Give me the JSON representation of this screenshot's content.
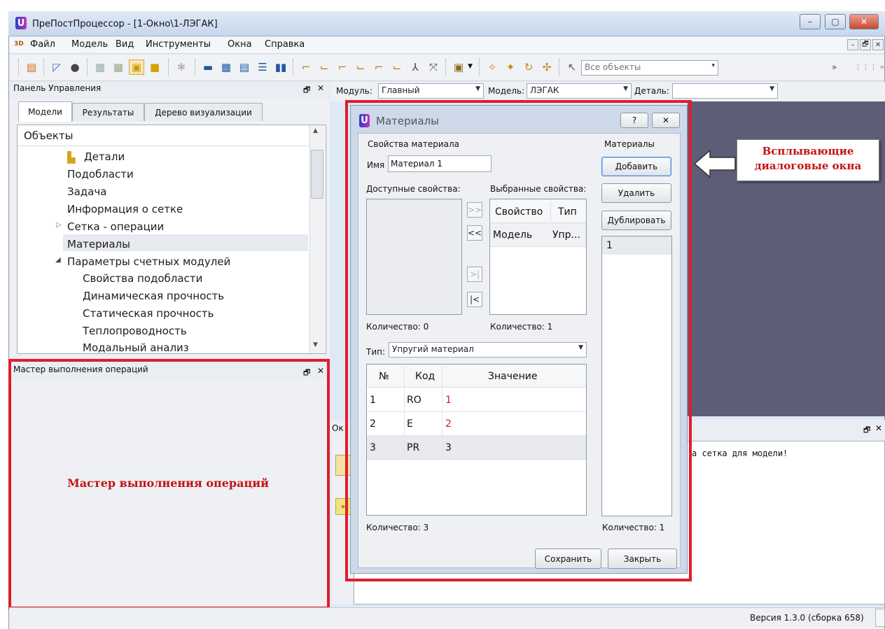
{
  "window": {
    "title": "ПреПостПроцессор - [1-Окно\\1-ЛЭГАК]",
    "logo_letter": "U",
    "minimize": "–",
    "maximize": "▢",
    "close": "✕"
  },
  "menu": {
    "app_icon_label": "3D",
    "items": [
      "Файл",
      "Модель",
      "Вид",
      "Инструменты",
      "Окна",
      "Справка"
    ],
    "mdi_controls": [
      "–",
      "🗗",
      "✕"
    ]
  },
  "toolbar": {
    "objects_filter": "Все объекты",
    "overflow": "»",
    "overflow2": "⋮⋮⋮ »"
  },
  "control_panel": {
    "title": "Панель Управления",
    "tabs": [
      "Модели",
      "Результаты",
      "Дерево визуализации"
    ],
    "tree_header": "Объекты",
    "tree_items": [
      {
        "label": "Детали",
        "folder": true
      },
      {
        "label": "Подобласти"
      },
      {
        "label": "Задача"
      },
      {
        "label": "Информация о сетке"
      },
      {
        "label": "Сетка - операции",
        "expander": "▷"
      },
      {
        "label": "Материалы",
        "selected": true
      },
      {
        "label": "Параметры счетных модулей",
        "expander": "◢"
      },
      {
        "label": "Свойства подобласти",
        "child": true
      },
      {
        "label": "Динамическая прочность",
        "child": true
      },
      {
        "label": "Статическая прочность",
        "child": true
      },
      {
        "label": "Теплопроводность",
        "child": true
      },
      {
        "label": "Модальный анализ",
        "child": true
      }
    ]
  },
  "module_bar": {
    "module_label": "Модуль:",
    "module_value": "Главный",
    "model_label": "Модель:",
    "model_value": "ЛЭГАК",
    "detail_label": "Деталь:",
    "detail_value": ""
  },
  "wizard_panel": {
    "title": "Мастер выполнения операций",
    "annotation": "Мастер выполнения операций"
  },
  "output_panel": {
    "tab_fragment": "Ок",
    "message": "а сетка для модели!"
  },
  "dialog": {
    "title": "Материалы",
    "help": "?",
    "close": "✕",
    "props_group": "Свойства материала",
    "name_label": "Имя",
    "name_value": "Материал 1",
    "available_label": "Доступные свойства:",
    "selected_label": "Выбранные свойства:",
    "arrow_buttons": [
      ">>",
      "<<",
      ">|",
      "|<"
    ],
    "selected_headers": [
      "Свойство",
      "Тип"
    ],
    "selected_rows": [
      [
        "Модель",
        "Упр..."
      ]
    ],
    "available_count": "Количество: 0",
    "selected_count": "Количество: 1",
    "type_label": "Тип:",
    "type_value": "Упругий материал",
    "table_headers": [
      "№",
      "Код",
      "Значение"
    ],
    "table_rows": [
      [
        "1",
        "RO",
        "1"
      ],
      [
        "2",
        "E",
        "2"
      ],
      [
        "3",
        "PR",
        "3"
      ]
    ],
    "table_count": "Количество: 3",
    "materials_group": "Материалы",
    "add_button": "Добавить",
    "delete_button": "Удалить",
    "duplicate_button": "Дублировать",
    "materials_list": [
      "1"
    ],
    "materials_count": "Количество: 1",
    "save_button": "Сохранить",
    "close_button": "Закрыть"
  },
  "annotations": {
    "popup_line1": "Всплывающие",
    "popup_line2": "диалоговые окна"
  },
  "status": {
    "version": "Версия 1.3.0 (сборка 658)"
  },
  "colors": {
    "frame_red": "#e01d2c",
    "annotation_red": "#c21313",
    "value_red": "#cc1f1f",
    "viewport": "#5e5d78"
  }
}
